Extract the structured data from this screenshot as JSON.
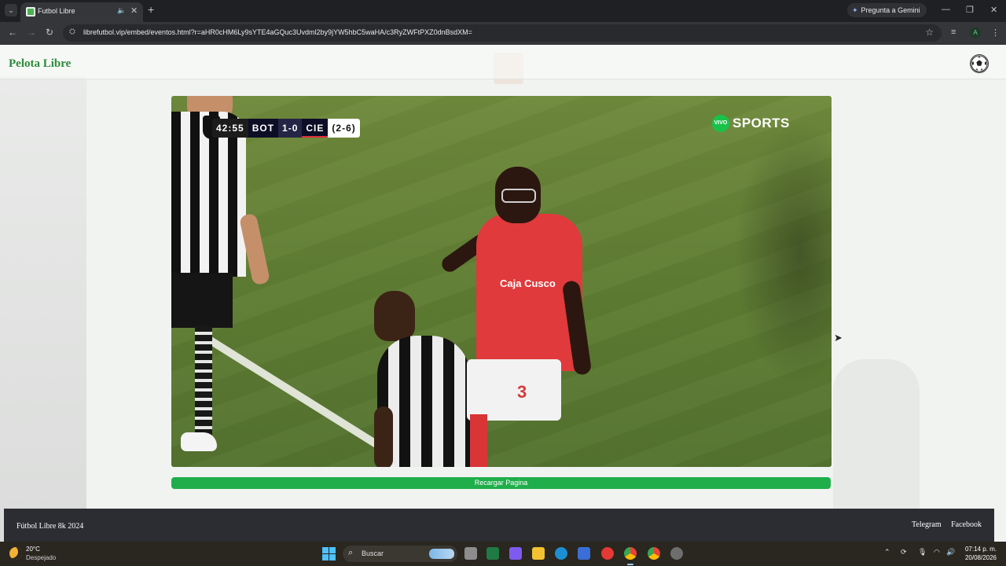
{
  "browser": {
    "tab_menu_icon": "chevron-down-icon",
    "tab_title": "Futbol Libre",
    "tab_audio_icon": "speaker-icon",
    "tab_close_icon": "close-icon",
    "new_tab_icon": "plus-icon",
    "gemini_label": "Pregunta a Gemini",
    "window_minimize": "—",
    "window_restore": "❐",
    "window_close": "✕",
    "back_glyph": "←",
    "forward_glyph": "→",
    "reload_glyph": "↻",
    "site_info_glyph": "⛭",
    "url": "librefutbol.vip/embed/eventos.html?r=aHR0cHM6Ly9sYTE4aGQuc3Uvdml2by9jYW5hbC5waHA/c3RyZWFtPXZ0dnBsdXM=",
    "bookmark_glyph": "☆",
    "media_glyph": "≡",
    "profile_initial": "A",
    "menu_glyph": "⋮"
  },
  "site": {
    "brand": "Pelota Libre",
    "logo_icon": "soccer-ball-icon",
    "reload_button": "Recargar Pagina",
    "footer_copy": "Fútbol Libre 8k 2024",
    "footer_links": [
      "Telegram",
      "Facebook"
    ]
  },
  "video": {
    "scoreboard": {
      "time": "42:55",
      "team_home": "BOT",
      "score": "1-0",
      "team_away": "CIE",
      "aggregate": "(2-6)"
    },
    "broadcaster_live": "VIVO",
    "broadcaster_name": "SPORTS",
    "shirt_number": "3",
    "sponsor": "Caja Cusco"
  },
  "taskbar": {
    "weather_temp": "20°C",
    "weather_desc": "Despejado",
    "search_label": "Buscar",
    "tray_up": "⌃",
    "tray_wifi": "◠",
    "tray_volume": "🔊",
    "time": "07:14 p. m.",
    "date": "20/08/2026"
  },
  "colors": {
    "brand_green": "#2e8b3a",
    "reload_green": "#1fae4a",
    "footer_bg": "#2b2d33",
    "away_team_red": "#e0303a"
  }
}
